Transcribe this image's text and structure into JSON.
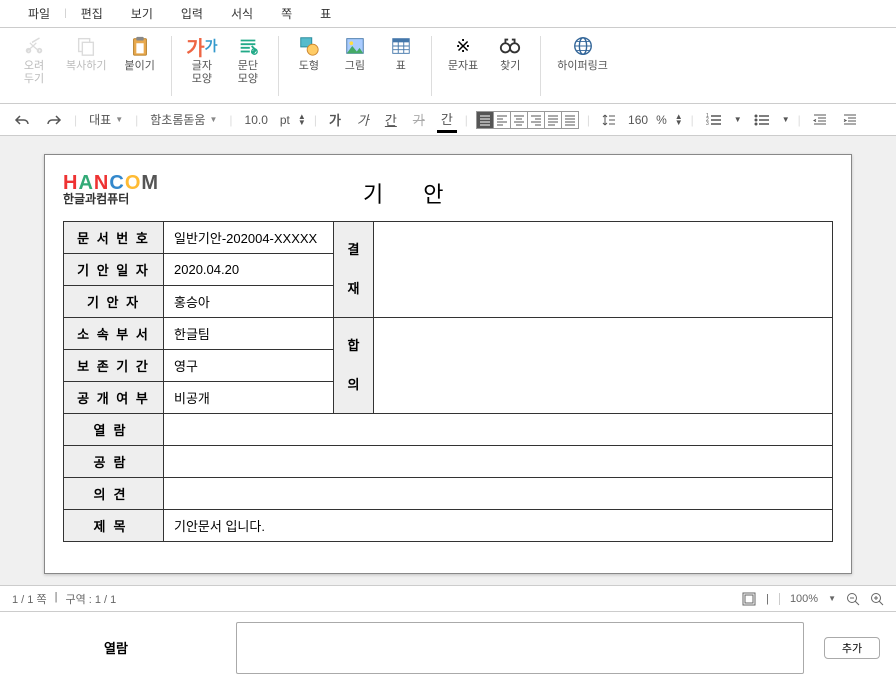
{
  "menu": {
    "file": "파일",
    "edit": "편집",
    "view": "보기",
    "input": "입력",
    "format": "서식",
    "page": "쪽",
    "table": "표"
  },
  "ribbon": {
    "cut": "오려\n두기",
    "copy": "복사하기",
    "paste": "붙이기",
    "charShape": "글자\n모양",
    "paraShape": "문단\n모양",
    "shape": "도형",
    "picture": "그림",
    "tableBtn": "표",
    "charTable": "문자표",
    "find": "찾기",
    "hyperlink": "하이퍼링크"
  },
  "formatbar": {
    "styleName": "대표",
    "fontName": "함초롬돋움",
    "fontSize": "10.0",
    "fontUnit": "pt",
    "bold": "가",
    "italic": "가",
    "underline": "간",
    "strike": "가",
    "charColor": "간",
    "lineSpacing": "160",
    "percent": "%"
  },
  "status": {
    "pageInfo": "1 / 1 쪽",
    "sectionInfo": "구역 : 1 / 1",
    "zoom": "100%"
  },
  "document": {
    "logoSub": "한글과컴퓨터",
    "title": "기안",
    "fields": {
      "docNoLabel": "문 서 번 호",
      "docNoValue": "일반기안-202004-XXXXX",
      "draftDateLabel": "기 안 일 자",
      "draftDateValue": "2020.04.20",
      "drafterLabel": "기  안  자",
      "drafterValue": "홍승아",
      "deptLabel": "소 속 부 서",
      "deptValue": "한글팀",
      "retentionLabel": "보 존 기 간",
      "retentionValue": "영구",
      "publicLabel": "공 개 여 부",
      "publicValue": "비공개",
      "approvalLabel": "결\n\n재",
      "agreementLabel": "합\n\n의",
      "circulationLabel": "열람",
      "shareLabel": "공람",
      "opinionLabel": "의견",
      "subjectLabel": "제목",
      "subjectValue": "기안문서 입니다."
    }
  },
  "panel": {
    "label": "열람",
    "addButton": "추가"
  }
}
